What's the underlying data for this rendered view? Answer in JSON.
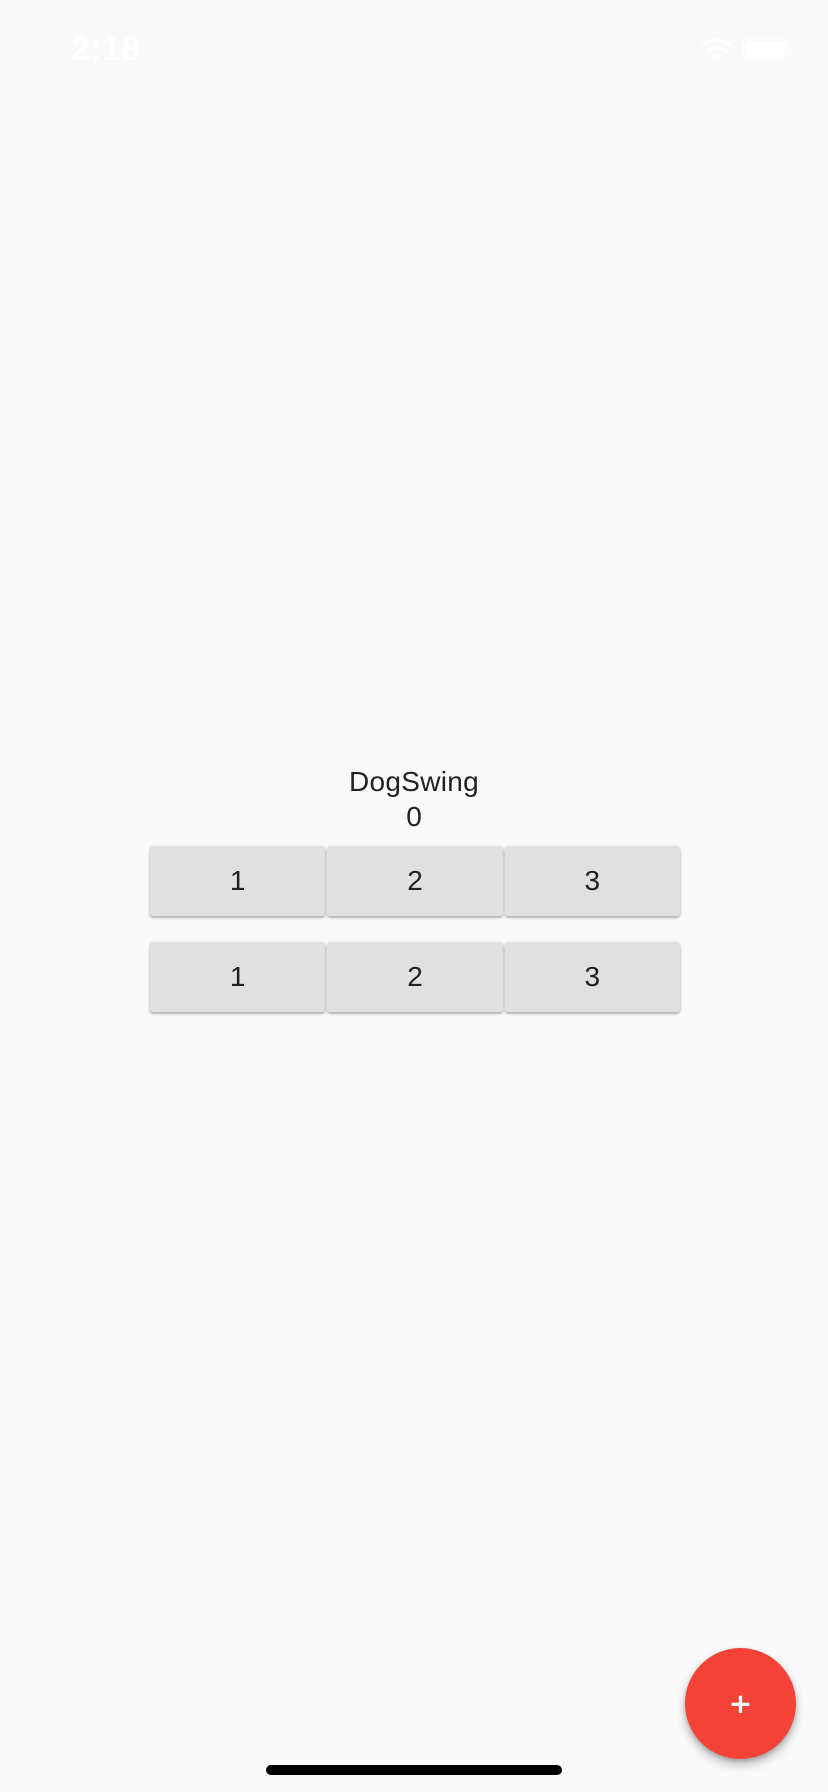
{
  "status_bar": {
    "time": "2:18",
    "icons": [
      "wifi-icon",
      "battery-icon"
    ]
  },
  "main": {
    "title": "DogSwing",
    "counter": "0",
    "button_rows": [
      {
        "buttons": [
          {
            "label": "1"
          },
          {
            "label": "2"
          },
          {
            "label": "3"
          }
        ]
      },
      {
        "buttons": [
          {
            "label": "1"
          },
          {
            "label": "2"
          },
          {
            "label": "3"
          }
        ]
      }
    ]
  },
  "fab": {
    "label": "+",
    "icon": "plus-icon"
  },
  "colors": {
    "background": "#fafafa",
    "button": "#e0e0e0",
    "fab": "#f44336",
    "text": "#212121"
  }
}
